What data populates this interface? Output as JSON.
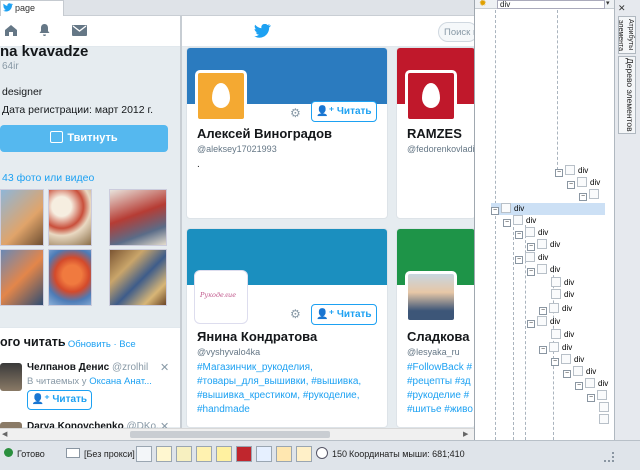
{
  "browser": {
    "tab_title": "page"
  },
  "twitter": {
    "search_placeholder": "Поиск в",
    "profile": {
      "name": "na kvavadze",
      "handle": "64ir",
      "bio": "designer",
      "registered": "Дата регистрации: март 2012 г."
    },
    "tweet_button": "Твитнуть",
    "photos_link": "43 фото или видео",
    "who_to_follow": {
      "title": "ого читать",
      "refresh": "Обновить",
      "all": "Все",
      "user1": {
        "name": "Челпанов Денис",
        "handle": "@zrolhil",
        "followed_by_prefix": "В читаемых у",
        "followed_by": "Оксана Анат...",
        "follow_label": "Читать"
      },
      "user2": {
        "name": "Darya Konovchenko",
        "handle": "@DKo..."
      }
    },
    "cards": [
      {
        "name": "Алексей Виноградов",
        "handle": "@aleksey17021993",
        "bio": [
          "."
        ],
        "follow_label": "Читать",
        "banner_color": "#2b7bbf",
        "avatar_color": "#f4a932"
      },
      {
        "name": "RAMZES",
        "handle": "@fedorenkovladi2",
        "bio": [],
        "follow_label": "Читать",
        "banner_color": "#c0182b",
        "avatar_color": "#c0182b"
      },
      {
        "name": "Янина Кондратова",
        "handle": "@vyshyvalo4ka",
        "bio": [
          "#Магазинчик_рукоделия,",
          "#товары_для_вышивки, #вышивка,",
          "#вышивка_крестиком, #рукоделие,",
          "#handmade"
        ],
        "follow_label": "Читать",
        "banner_color": "#1b8fbf",
        "avatar_text": "Рукоделие"
      },
      {
        "name": "Сладкова",
        "handle": "@lesyaka_ru",
        "bio": [
          "#FollowBack #",
          "#рецепты #зд",
          "#рукоделие #",
          "#шитье #живо"
        ],
        "follow_label": "Читать",
        "banner_color": "#1e9448"
      }
    ]
  },
  "devtools": {
    "selected_element": "div",
    "tabs": [
      "Атрибуты элемента",
      "Дерево элементов"
    ],
    "tree_label": "div"
  },
  "statusbar": {
    "ready": "Готово",
    "proxy": "[Без прокси]",
    "counter": "150",
    "mouse_coords": "Координаты мыши: 681;410"
  }
}
